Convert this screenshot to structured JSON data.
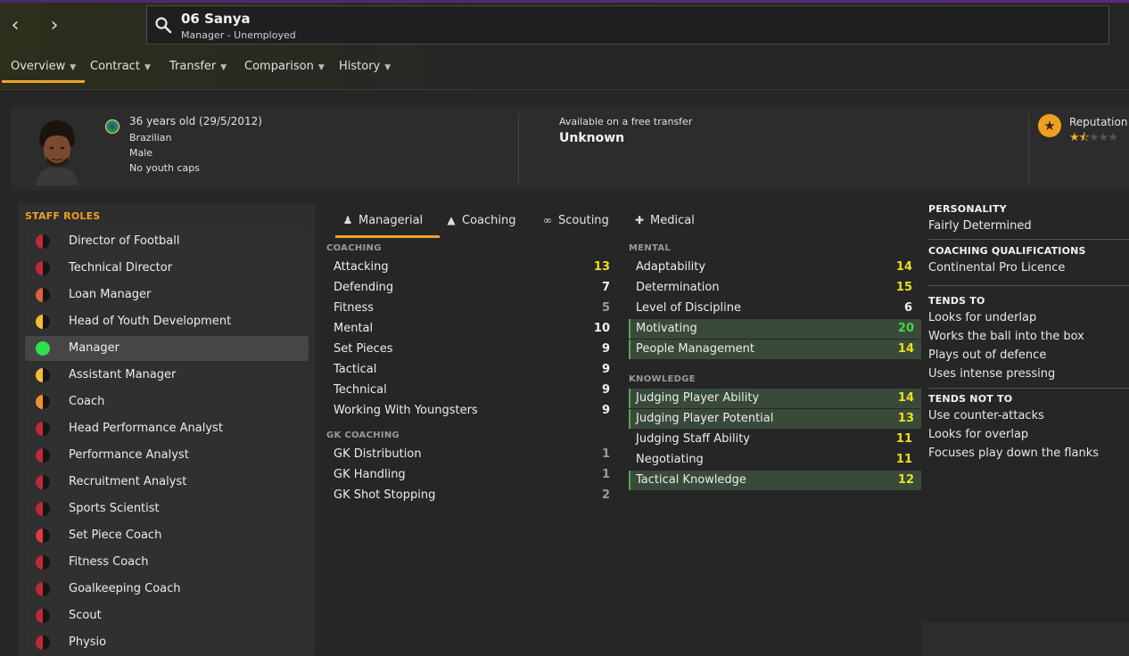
{
  "nav": {
    "back_glyph": "‹",
    "forward_glyph": "›"
  },
  "search": {
    "name": "06 Sanya",
    "subtitle": "Manager - Unemployed"
  },
  "tabs": [
    {
      "label": "Overview"
    },
    {
      "label": "Contract"
    },
    {
      "label": "Transfer"
    },
    {
      "label": "Comparison"
    },
    {
      "label": "History"
    }
  ],
  "profile": {
    "age": "36 years old (29/5/2012)",
    "nationality": "Brazilian",
    "gender": "Male",
    "caps": "No youth caps",
    "availability_label": "Available on a free transfer",
    "availability_value": "Unknown",
    "reputation_label": "Reputation",
    "reputation_stars": 1.5,
    "reputation_max": 5
  },
  "staff_roles": {
    "title": "STAFF ROLES",
    "items": [
      {
        "label": "Director of Football",
        "color": "#c0283a",
        "level": "half"
      },
      {
        "label": "Technical Director",
        "color": "#c0283a",
        "level": "half"
      },
      {
        "label": "Loan Manager",
        "color": "#e06040",
        "level": "half"
      },
      {
        "label": "Head of Youth Development",
        "color": "#f0c030",
        "level": "half"
      },
      {
        "label": "Manager",
        "color": "#30e050",
        "level": "full"
      },
      {
        "label": "Assistant Manager",
        "color": "#f0c030",
        "level": "half"
      },
      {
        "label": "Coach",
        "color": "#f09030",
        "level": "half"
      },
      {
        "label": "Head Performance Analyst",
        "color": "#c0283a",
        "level": "half"
      },
      {
        "label": "Performance Analyst",
        "color": "#c0283a",
        "level": "half"
      },
      {
        "label": "Recruitment Analyst",
        "color": "#c0283a",
        "level": "half"
      },
      {
        "label": "Sports Scientist",
        "color": "#c0283a",
        "level": "half"
      },
      {
        "label": "Set Piece Coach",
        "color": "#e03a40",
        "level": "half"
      },
      {
        "label": "Fitness Coach",
        "color": "#c0283a",
        "level": "half"
      },
      {
        "label": "Goalkeeping Coach",
        "color": "#c0283a",
        "level": "half"
      },
      {
        "label": "Scout",
        "color": "#c0283a",
        "level": "half"
      },
      {
        "label": "Physio",
        "color": "#c0283a",
        "level": "half"
      }
    ]
  },
  "attr_tabs": [
    {
      "label": "Managerial",
      "icon": "managerial-icon"
    },
    {
      "label": "Coaching",
      "icon": "coaching-icon"
    },
    {
      "label": "Scouting",
      "icon": "binoculars-icon"
    },
    {
      "label": "Medical",
      "icon": "medical-kit-icon"
    }
  ],
  "coaching": {
    "title": "COACHING",
    "items": [
      {
        "name": "Attacking",
        "value": "13",
        "class": "v-good",
        "hl": false
      },
      {
        "name": "Defending",
        "value": "7",
        "class": "v-mid",
        "hl": false
      },
      {
        "name": "Fitness",
        "value": "5",
        "class": "v-low",
        "hl": false
      },
      {
        "name": "Mental",
        "value": "10",
        "class": "v-mid",
        "hl": false
      },
      {
        "name": "Set Pieces",
        "value": "9",
        "class": "v-mid",
        "hl": false
      },
      {
        "name": "Tactical",
        "value": "9",
        "class": "v-mid",
        "hl": false
      },
      {
        "name": "Technical",
        "value": "9",
        "class": "v-mid",
        "hl": false
      },
      {
        "name": "Working With Youngsters",
        "value": "9",
        "class": "v-mid",
        "hl": false
      }
    ]
  },
  "gk_coaching": {
    "title": "GK COACHING",
    "items": [
      {
        "name": "GK Distribution",
        "value": "1",
        "class": "v-low",
        "hl": false
      },
      {
        "name": "GK Handling",
        "value": "1",
        "class": "v-low",
        "hl": false
      },
      {
        "name": "GK Shot Stopping",
        "value": "2",
        "class": "v-low",
        "hl": false
      }
    ]
  },
  "mental": {
    "title": "MENTAL",
    "items": [
      {
        "name": "Adaptability",
        "value": "14",
        "class": "v-good",
        "hl": false
      },
      {
        "name": "Determination",
        "value": "15",
        "class": "v-good",
        "hl": false
      },
      {
        "name": "Level of Discipline",
        "value": "6",
        "class": "v-mid",
        "hl": false
      },
      {
        "name": "Motivating",
        "value": "20",
        "class": "v-great",
        "hl": true
      },
      {
        "name": "People Management",
        "value": "14",
        "class": "v-good",
        "hl": true
      }
    ]
  },
  "knowledge": {
    "title": "KNOWLEDGE",
    "items": [
      {
        "name": "Judging Player Ability",
        "value": "14",
        "class": "v-good",
        "hl": true
      },
      {
        "name": "Judging Player Potential",
        "value": "13",
        "class": "v-good",
        "hl": true
      },
      {
        "name": "Judging Staff Ability",
        "value": "11",
        "class": "v-good",
        "hl": false
      },
      {
        "name": "Negotiating",
        "value": "11",
        "class": "v-good",
        "hl": false
      },
      {
        "name": "Tactical Knowledge",
        "value": "12",
        "class": "v-good",
        "hl": true
      }
    ]
  },
  "personality": {
    "title": "PERSONALITY",
    "value": "Fairly Determined"
  },
  "qualifications": {
    "title": "COACHING QUALIFICATIONS",
    "value": "Continental Pro Licence"
  },
  "tends_to": {
    "title": "TENDS TO",
    "items": [
      "Looks for underlap",
      "Works the ball into the box",
      "Plays out of defence",
      "Uses intense pressing"
    ]
  },
  "tends_not_to": {
    "title": "TENDS NOT TO",
    "items": [
      "Use counter-attacks",
      "Looks for overlap",
      "Focuses play down the flanks"
    ]
  },
  "colors": {
    "accent": "#f0a030",
    "highlight_row": "#3a4a3a",
    "good": "#e8e020",
    "great": "#40d840"
  }
}
